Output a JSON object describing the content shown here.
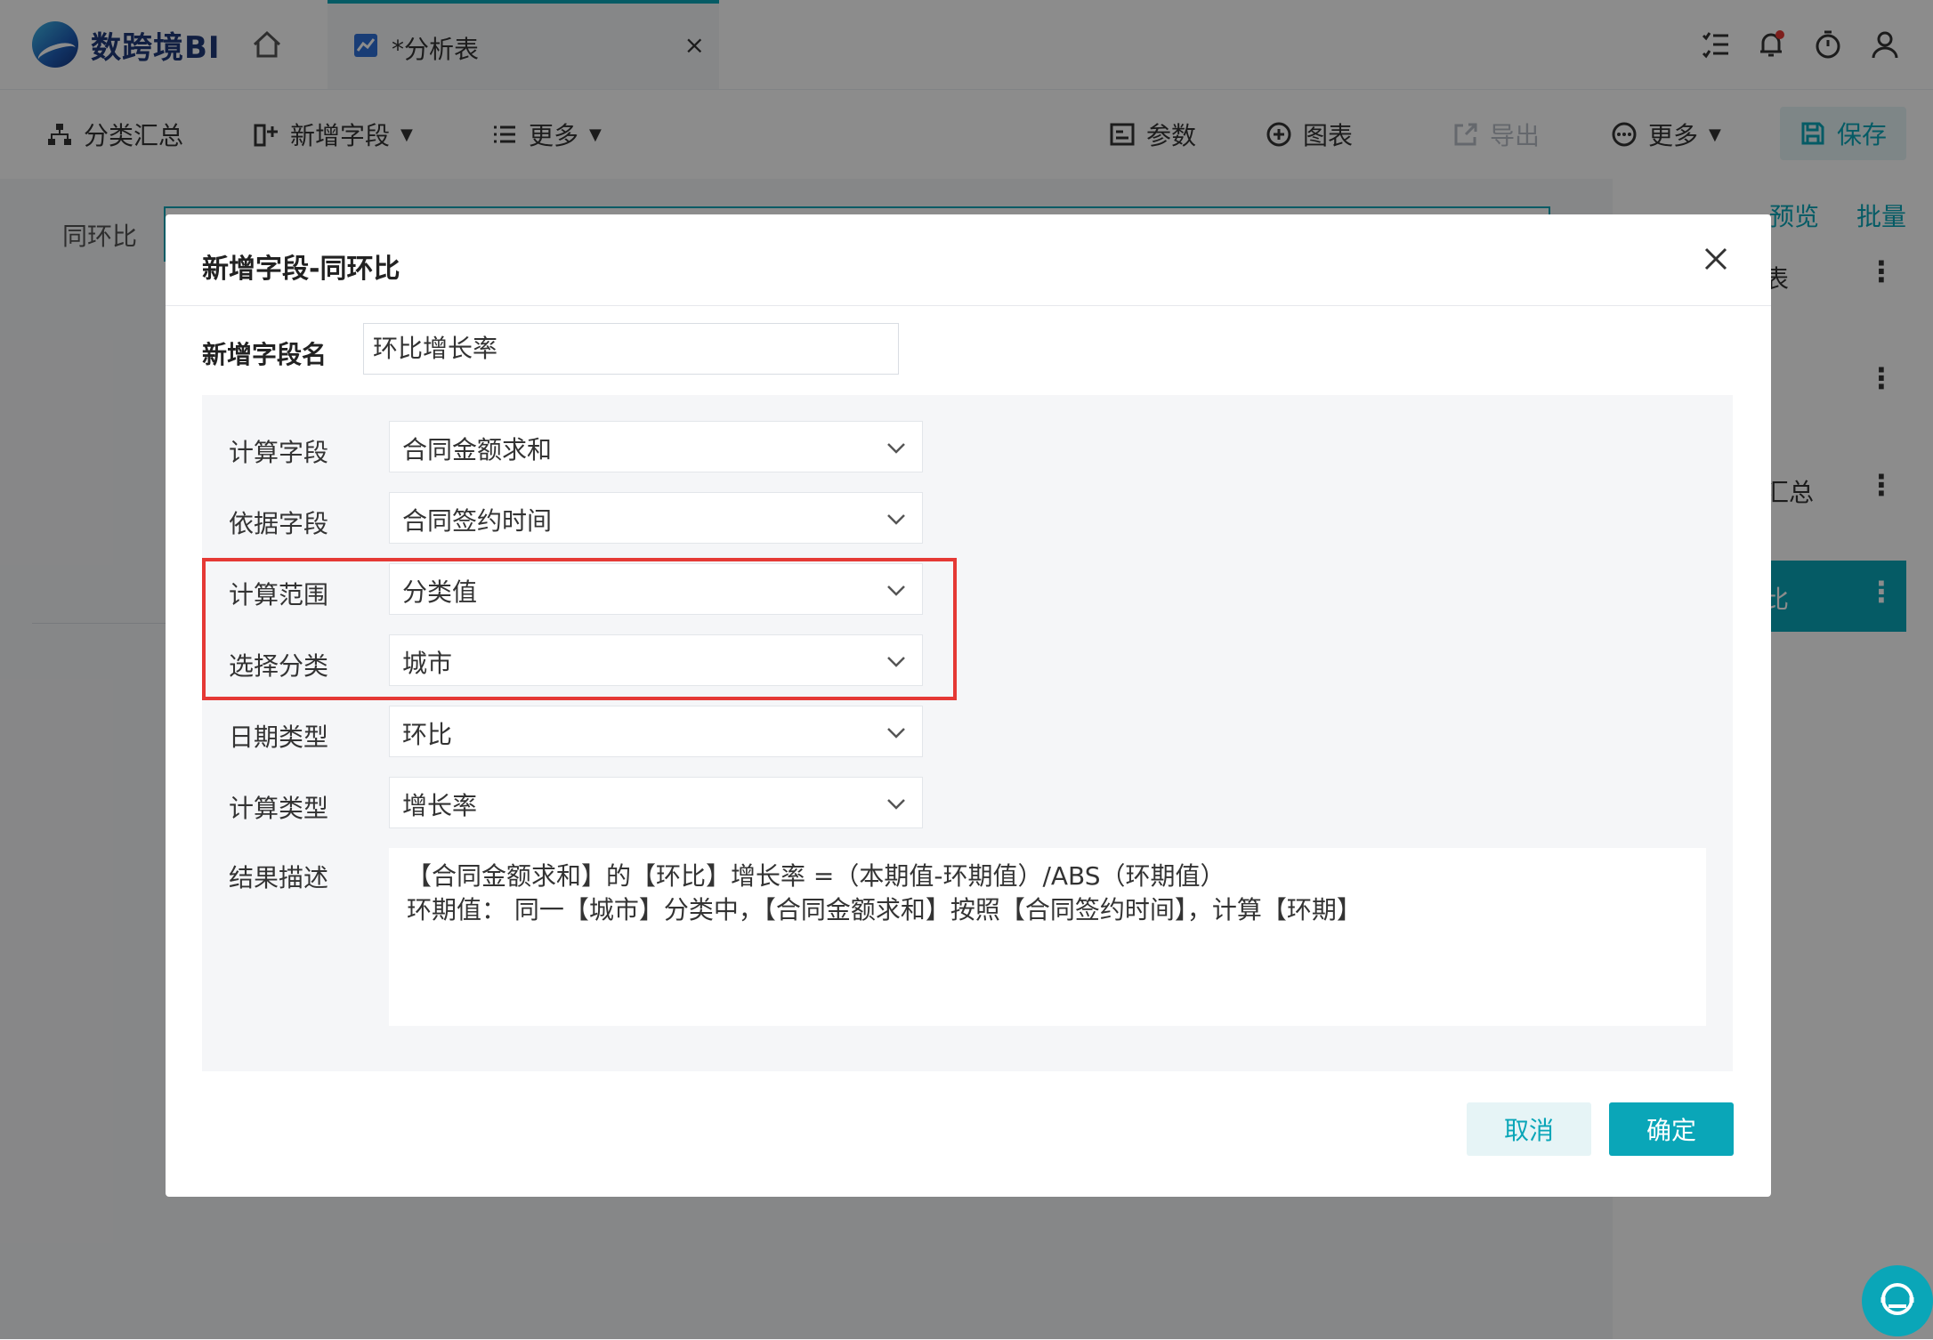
{
  "app": {
    "logo_text": "数跨境BI"
  },
  "tabs": {
    "active_label": "*分析表",
    "close_glyph": "×"
  },
  "toolbar": {
    "category_summary": "分类汇总",
    "add_field": "新增字段",
    "more_left": "更多",
    "params": "参数",
    "chart": "图表",
    "export": "导出",
    "more_right": "更多",
    "save": "保存"
  },
  "background": {
    "left_label": "同环比",
    "right_links": {
      "preview": "预览",
      "batch": "批量"
    },
    "right_items": [
      {
        "label": "表",
        "more": "⋮"
      },
      {
        "label": "",
        "more": "⋮"
      },
      {
        "label": "汇总",
        "more": "⋮"
      },
      {
        "label": "比",
        "more": "⋮"
      }
    ]
  },
  "dialog": {
    "title": "新增字段-同环比",
    "name_label": "新增字段名",
    "name_value": "环比增长率",
    "rows": [
      {
        "label": "计算字段",
        "value": "合同金额求和"
      },
      {
        "label": "依据字段",
        "value": "合同签约时间"
      },
      {
        "label": "计算范围",
        "value": "分类值"
      },
      {
        "label": "选择分类",
        "value": "城市"
      },
      {
        "label": "日期类型",
        "value": "环比"
      },
      {
        "label": "计算类型",
        "value": "增长率"
      }
    ],
    "result_label": "结果描述",
    "result_lines": [
      "【合同金额求和】的【环比】增长率 =（本期值-环期值）/ABS（环期值）",
      "环期值： 同一【城市】分类中，【合同金额求和】按照【合同签约时间】，计算【环期】"
    ],
    "cancel": "取消",
    "ok": "确定"
  },
  "colors": {
    "accent": "#0aa6b8",
    "highlight": "#e53935"
  }
}
